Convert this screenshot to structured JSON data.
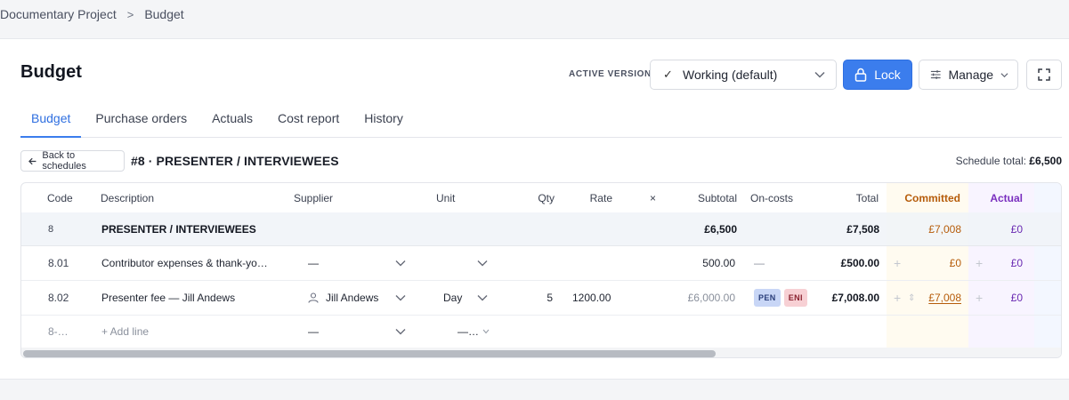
{
  "breadcrumb": {
    "project": "Documentary Project",
    "separator": ">",
    "current": "Budget"
  },
  "page": {
    "title": "Budget"
  },
  "version": {
    "caption": "ACTIVE VERSION",
    "selected": "Working (default)"
  },
  "toolbar": {
    "lock_label": "Lock",
    "manage_label": "Manage"
  },
  "tabs": [
    {
      "label": "Budget",
      "active": true
    },
    {
      "label": "Purchase orders",
      "active": false
    },
    {
      "label": "Actuals",
      "active": false
    },
    {
      "label": "Cost report",
      "active": false
    },
    {
      "label": "History",
      "active": false
    }
  ],
  "schedule": {
    "back_label": "Back to schedules",
    "title": "#8 · PRESENTER / INTERVIEWEES",
    "total_label": "Schedule total:",
    "total_value": "£6,500"
  },
  "table": {
    "headers": {
      "code": "Code",
      "description": "Description",
      "supplier": "Supplier",
      "unit": "Unit",
      "qty": "Qty",
      "rate": "Rate",
      "times": "×",
      "subtotal": "Subtotal",
      "oncosts": "On-costs",
      "total": "Total",
      "committed": "Committed",
      "actual": "Actual"
    },
    "group": {
      "code": "8",
      "description": "PRESENTER / INTERVIEWEES",
      "subtotal": "£6,500",
      "total": "£7,508",
      "committed": "£7,008",
      "actual": "£0"
    },
    "rows": [
      {
        "code": "8.01",
        "description": "Contributor expenses & thank-yo…",
        "supplier": "—",
        "subtotal": "500.00",
        "oncosts": "—",
        "total": "£500.00",
        "committed": "£0",
        "actual": "£0"
      },
      {
        "code": "8.02",
        "description": "Presenter fee — Jill Andews",
        "supplier": "Jill Andews",
        "unit": "Day",
        "qty": "5",
        "rate": "1200.00",
        "subtotal": "£6,000.00",
        "tags": [
          "PEN",
          "ENI"
        ],
        "total": "£7,008.00",
        "committed": "£7,008",
        "actual": "£0"
      }
    ],
    "add_row": {
      "code": "8-…",
      "description": "+ Add line",
      "supplier": "—",
      "unit": "—…"
    }
  },
  "icons": {
    "breadcrumb_sep": "chevron-right-icon",
    "version": "check-icon",
    "version_dropdown": "chevron-down-icon",
    "lock": "lock-icon",
    "manage": "sliders-icon",
    "expand": "fullscreen-icon",
    "back": "arrow-left-icon",
    "supplier": "person-icon"
  },
  "colors": {
    "accent": "#3b7ded",
    "committed": "#b65c0a",
    "actual": "#7a2fbf",
    "tag_pen": "#c8d6f6",
    "tag_eni": "#f7d0d4"
  }
}
